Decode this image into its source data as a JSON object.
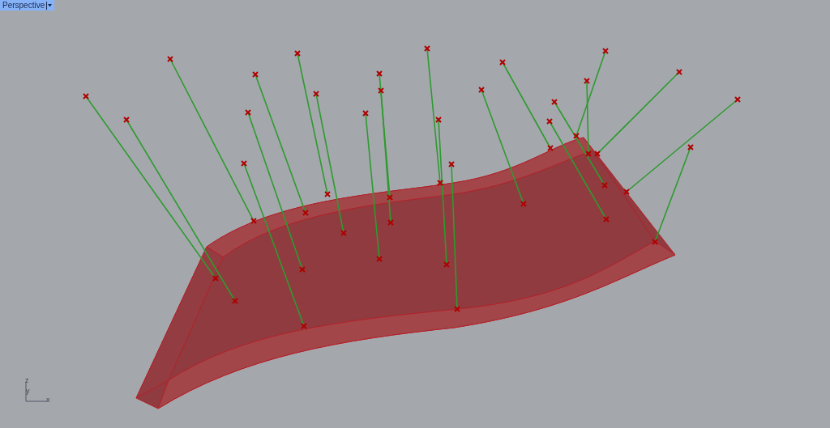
{
  "viewport": {
    "title": "Perspective"
  },
  "axes": {
    "z": "z",
    "y": "y",
    "x": "x"
  }
}
